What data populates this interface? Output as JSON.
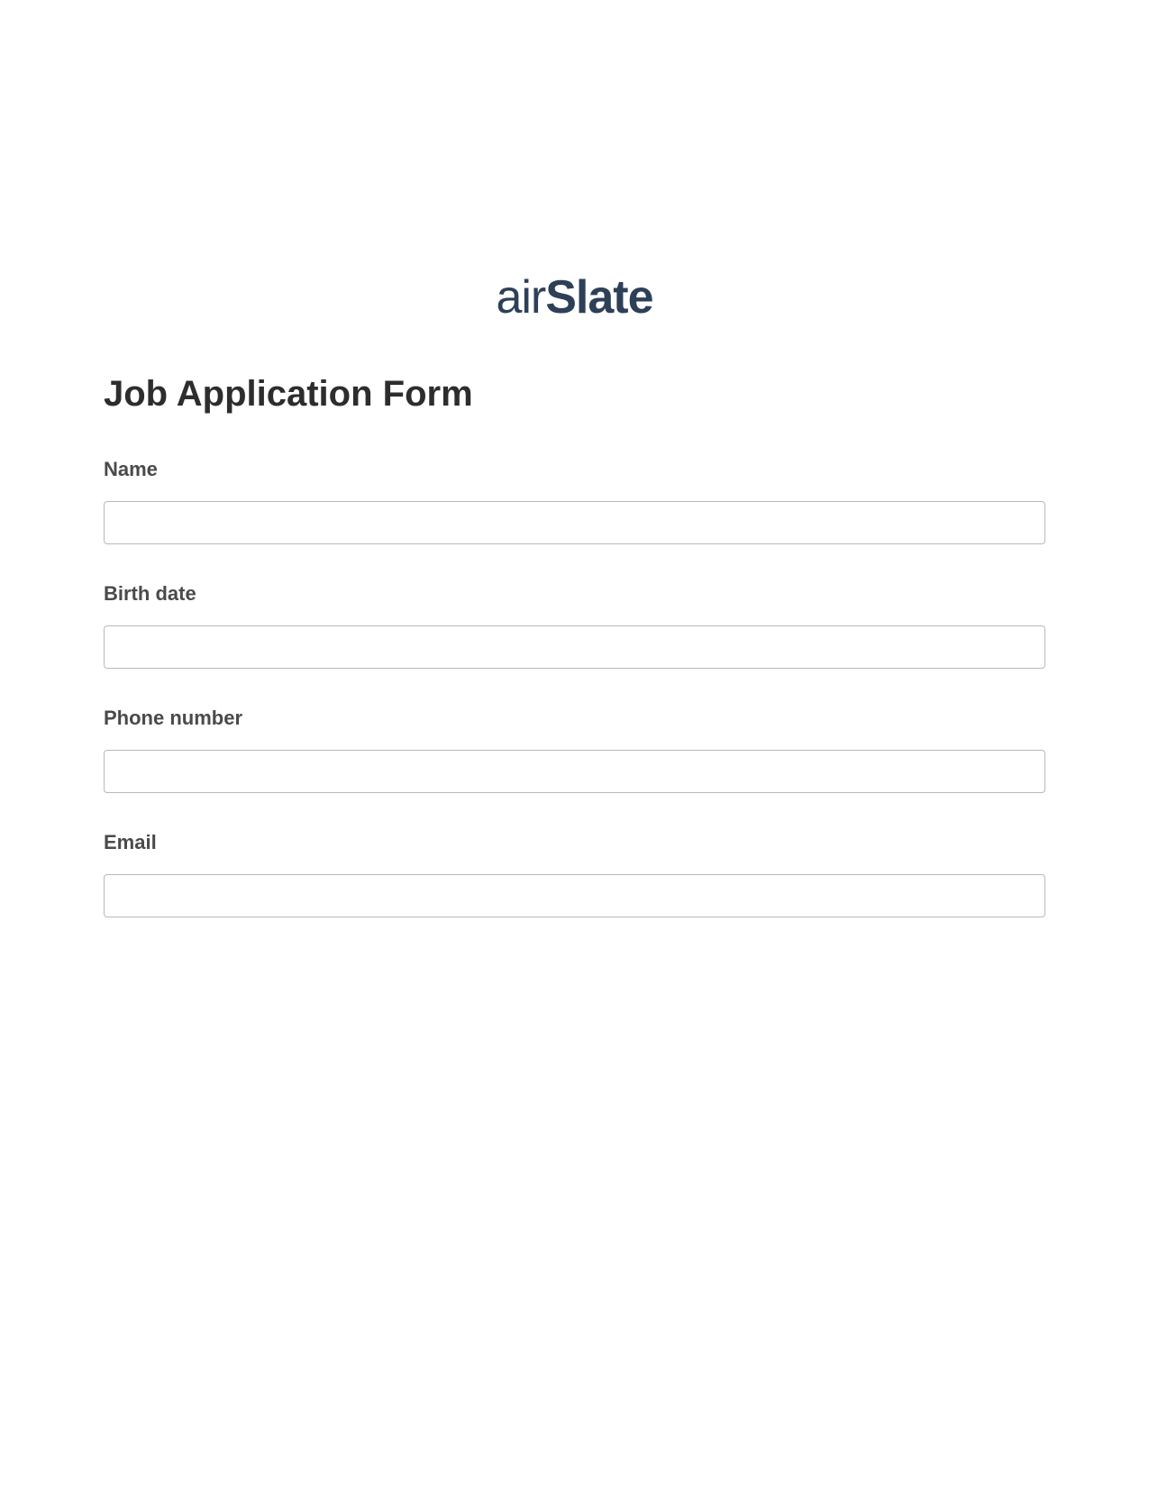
{
  "logo": {
    "prefix": "air",
    "suffix": "Slate"
  },
  "form": {
    "title": "Job Application Form",
    "fields": [
      {
        "label": "Name",
        "value": ""
      },
      {
        "label": "Birth date",
        "value": ""
      },
      {
        "label": "Phone number",
        "value": ""
      },
      {
        "label": "Email",
        "value": ""
      }
    ]
  }
}
